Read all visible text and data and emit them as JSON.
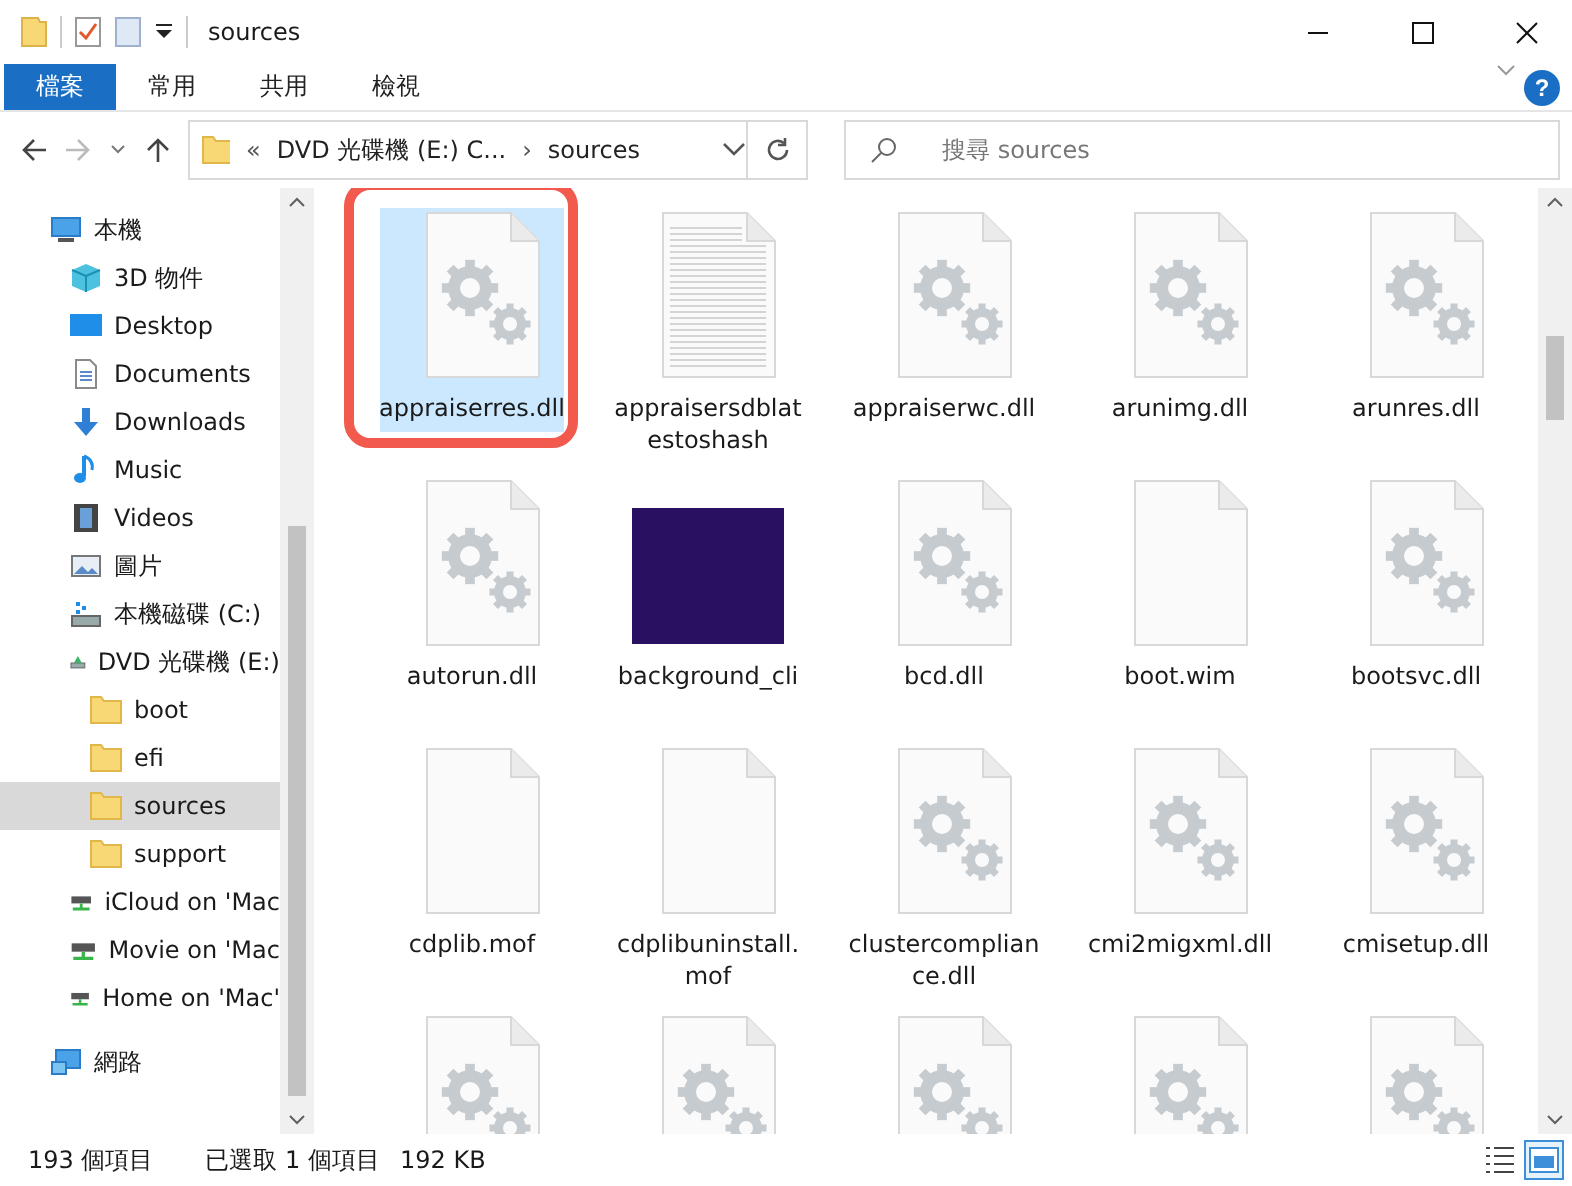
{
  "window": {
    "title": "sources"
  },
  "ribbon": {
    "tabs": [
      {
        "label": "檔案",
        "selected": true
      },
      {
        "label": "常用",
        "selected": false
      },
      {
        "label": "共用",
        "selected": false
      },
      {
        "label": "檢視",
        "selected": false
      }
    ],
    "help": "?"
  },
  "address": {
    "overflow": "«",
    "crumbs": [
      "DVD 光碟機 (E:) C...",
      "sources"
    ],
    "separator": "›"
  },
  "search": {
    "placeholder": "搜尋 sources"
  },
  "sidebar": {
    "items": [
      {
        "label": "本機",
        "kind": "pc",
        "selected": false,
        "children": [
          {
            "label": "3D 物件",
            "kind": "cube",
            "selected": false
          },
          {
            "label": "Desktop",
            "kind": "desktop",
            "selected": false
          },
          {
            "label": "Documents",
            "kind": "docs",
            "selected": false
          },
          {
            "label": "Downloads",
            "kind": "download",
            "selected": false
          },
          {
            "label": "Music",
            "kind": "music",
            "selected": false
          },
          {
            "label": "Videos",
            "kind": "video",
            "selected": false
          },
          {
            "label": "圖片",
            "kind": "picture",
            "selected": false
          },
          {
            "label": "本機磁碟 (C:)",
            "kind": "drive",
            "selected": false
          },
          {
            "label": "DVD 光碟機 (E:)",
            "kind": "dvd",
            "selected": false,
            "children": [
              {
                "label": "boot",
                "kind": "folder",
                "selected": false
              },
              {
                "label": "efi",
                "kind": "folder",
                "selected": false
              },
              {
                "label": "sources",
                "kind": "folder",
                "selected": true
              },
              {
                "label": "support",
                "kind": "folder",
                "selected": false
              }
            ]
          },
          {
            "label": "iCloud on 'Mac",
            "kind": "netdrive",
            "selected": false
          },
          {
            "label": "Movie on 'Mac",
            "kind": "netdrive",
            "selected": false
          },
          {
            "label": "Home on 'Mac'",
            "kind": "netdrive",
            "selected": false
          }
        ]
      },
      {
        "label": "網路",
        "kind": "network",
        "selected": false
      }
    ]
  },
  "files": [
    {
      "name": "appraiserres.dll",
      "kind": "gear",
      "selected": true,
      "highlighted": true
    },
    {
      "name": "appraisersdblatestoshash",
      "kind": "text",
      "selected": false,
      "highlighted": false
    },
    {
      "name": "appraiserwc.dll",
      "kind": "gear",
      "selected": false,
      "highlighted": false
    },
    {
      "name": "arunimg.dll",
      "kind": "gear",
      "selected": false,
      "highlighted": false
    },
    {
      "name": "arunres.dll",
      "kind": "gear",
      "selected": false,
      "highlighted": false
    },
    {
      "name": "autorun.dll",
      "kind": "gear",
      "selected": false,
      "highlighted": false
    },
    {
      "name": "background_cli",
      "kind": "image",
      "color": "#2a1060",
      "selected": false,
      "highlighted": false
    },
    {
      "name": "bcd.dll",
      "kind": "gear",
      "selected": false,
      "highlighted": false
    },
    {
      "name": "boot.wim",
      "kind": "blank",
      "selected": false,
      "highlighted": false
    },
    {
      "name": "bootsvc.dll",
      "kind": "gear",
      "selected": false,
      "highlighted": false
    },
    {
      "name": "cdplib.mof",
      "kind": "blank",
      "selected": false,
      "highlighted": false
    },
    {
      "name": "cdplibuninstall.mof",
      "kind": "blank",
      "selected": false,
      "highlighted": false
    },
    {
      "name": "clustercompliance.dll",
      "kind": "gear",
      "selected": false,
      "highlighted": false
    },
    {
      "name": "cmi2migxml.dll",
      "kind": "gear",
      "selected": false,
      "highlighted": false
    },
    {
      "name": "cmisetup.dll",
      "kind": "gear",
      "selected": false,
      "highlighted": false
    },
    {
      "kind": "gear",
      "selected": false
    },
    {
      "kind": "gear",
      "selected": false
    },
    {
      "kind": "gear",
      "selected": false
    },
    {
      "kind": "gear",
      "selected": false
    },
    {
      "kind": "gear",
      "selected": false
    }
  ],
  "status_bar": {
    "count": "193 個項目",
    "selection": "已選取 1 個項目",
    "size": "192 KB",
    "views": [
      {
        "kind": "details",
        "selected": false
      },
      {
        "kind": "large",
        "selected": true
      }
    ]
  }
}
